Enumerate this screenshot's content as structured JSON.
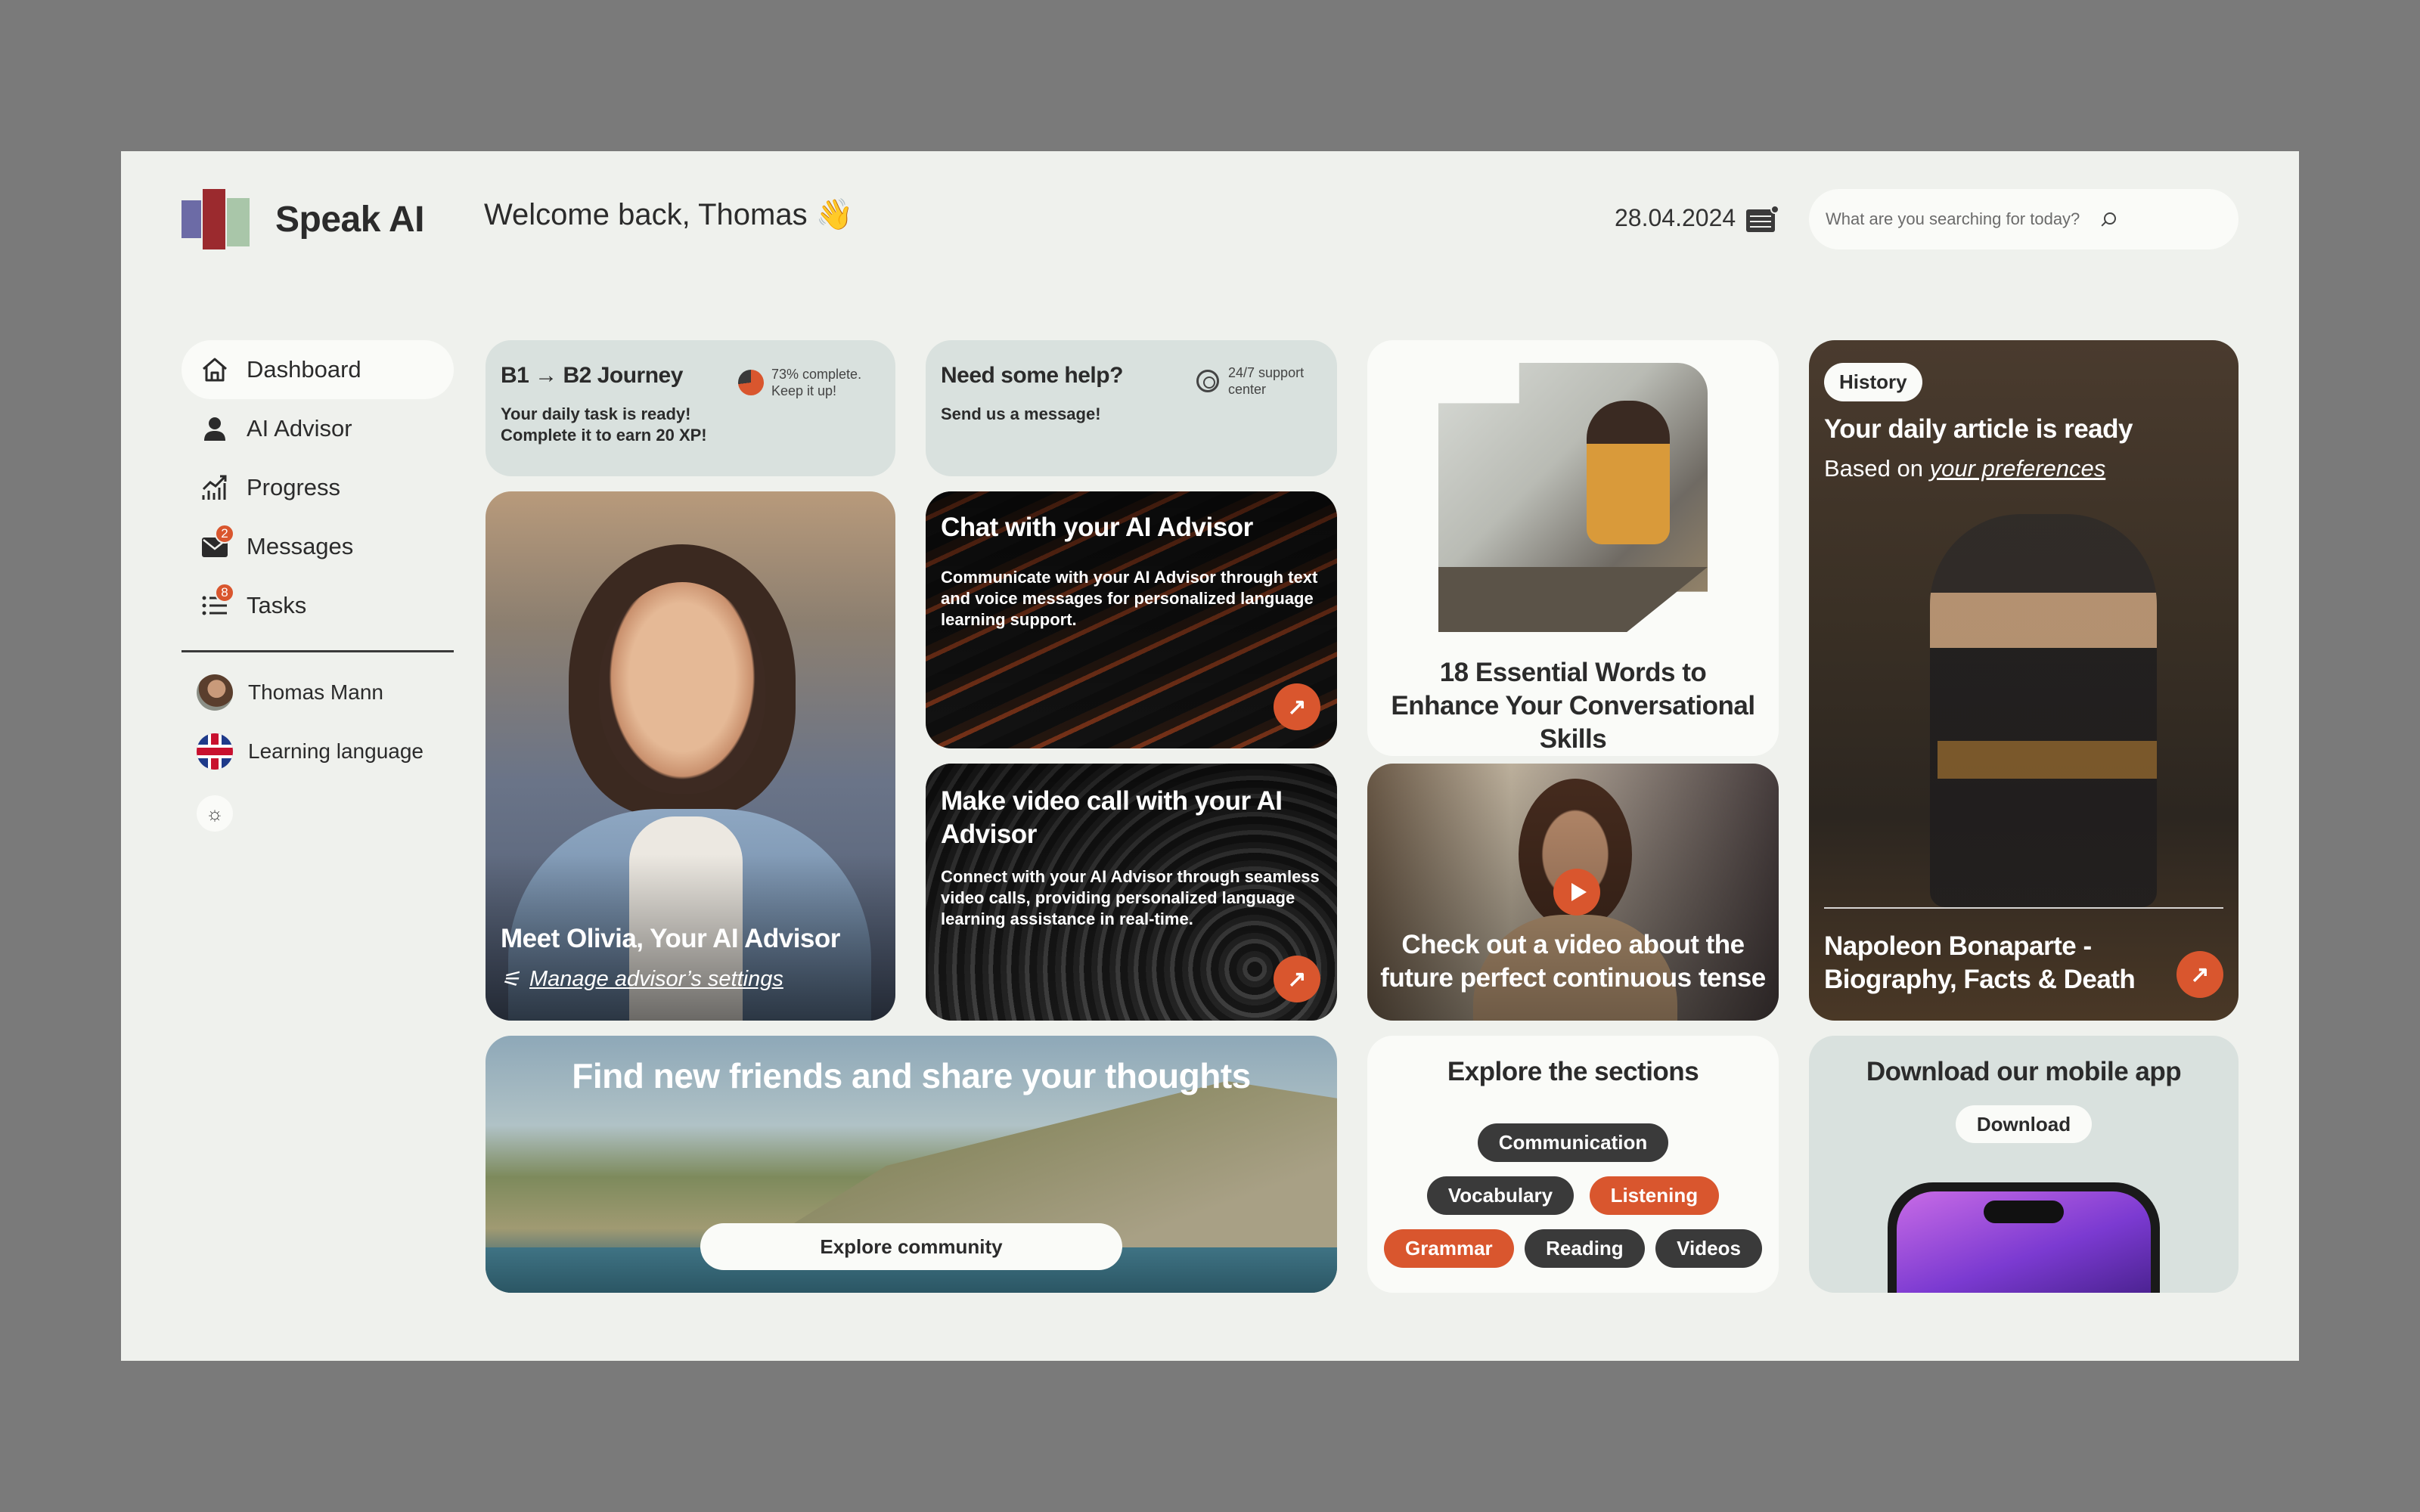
{
  "app": {
    "name": "Speak AI"
  },
  "header": {
    "welcome": "Welcome back, Thomas 👋",
    "date": "28.04.2024",
    "search_placeholder": "What are you searching for today?"
  },
  "sidebar": {
    "items": [
      {
        "label": "Dashboard",
        "icon": "home-icon",
        "active": true
      },
      {
        "label": "AI Advisor",
        "icon": "user-icon"
      },
      {
        "label": "Progress",
        "icon": "chart-up-icon"
      },
      {
        "label": "Messages",
        "icon": "mail-icon",
        "badge": "2"
      },
      {
        "label": "Tasks",
        "icon": "list-icon",
        "badge": "8"
      }
    ],
    "profile_name": "Thomas Mann",
    "learning_language": "Learning language",
    "theme_icon": "sun-icon"
  },
  "journey": {
    "title": "B1 → B2 Journey",
    "progress_percent": 73,
    "progress_text_1": "73% complete.",
    "progress_text_2": "Keep it up!",
    "line1": "Your daily task is ready!",
    "line2": "Complete it to earn 20 XP!"
  },
  "help": {
    "title": "Need some help?",
    "support_1": "24/7 support",
    "support_2": "center",
    "line": "Send us a message!"
  },
  "olivia": {
    "title": "Meet Olivia, Your AI Advisor",
    "link": "Manage advisor’s settings"
  },
  "chat": {
    "title": "Chat with your AI Advisor",
    "desc": "Communicate with your AI Advisor through text and voice messages for personalized language learning support."
  },
  "video_call": {
    "title": "Make video call with your AI Advisor",
    "desc": "Connect with your AI Advisor through seamless video calls, providing personalized language learning assistance in real-time."
  },
  "words": {
    "title": "18 Essential Words to Enhance Your Conversational Skills"
  },
  "video": {
    "title": "Check out a video about the future perfect continuous tense"
  },
  "history": {
    "tag": "History",
    "title": "Your daily article is ready",
    "subtitle_prefix": "Based on",
    "subtitle_link": "your preferences",
    "article_title": "Napoleon Bonaparte - Biography, Facts & Death"
  },
  "community": {
    "title": "Find new friends and share your thoughts",
    "button": "Explore community"
  },
  "sections": {
    "title": "Explore the sections",
    "tags": [
      "Communication",
      "Vocabulary",
      "Listening",
      "Grammar",
      "Reading",
      "Videos"
    ]
  },
  "app_download": {
    "title": "Download our mobile app",
    "button": "Download"
  },
  "colors": {
    "accent": "#d9562e",
    "background": "#eff1ed",
    "card_light": "#d9e1de",
    "card_white": "#fafbf8",
    "dark": "#3a3a3a"
  }
}
